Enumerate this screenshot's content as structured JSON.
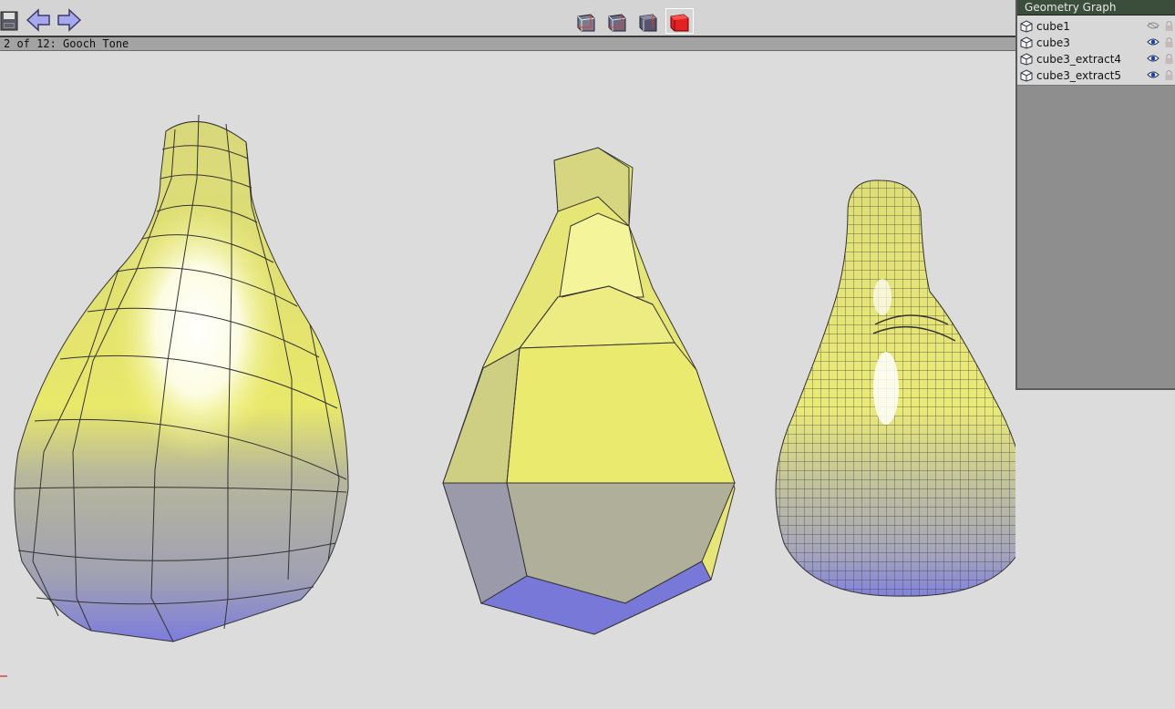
{
  "status": {
    "text": "2 of 12: Gooch Tone"
  },
  "panel": {
    "title": "Geometry Graph",
    "items": [
      {
        "label": "cube1",
        "visible": false
      },
      {
        "label": "cube3",
        "visible": true
      },
      {
        "label": "cube3_extract4",
        "visible": true
      },
      {
        "label": "cube3_extract5",
        "visible": true
      }
    ]
  },
  "icons": {
    "save": "save-icon",
    "back": "arrow-left-icon",
    "forward": "arrow-right-icon",
    "view_modes": [
      "wireframe-cube-icon",
      "hidden-line-cube-icon",
      "shaded-wire-cube-icon",
      "solid-cube-icon"
    ],
    "object": "cube-icon",
    "visibility": "eye-icon",
    "lock": "lock-icon"
  },
  "colors": {
    "gooch_warm": "#f0f070",
    "gooch_cool": "#7a7ae0",
    "mesh_edge": "#333333",
    "panel_title_bg": "#3b4e3b"
  }
}
